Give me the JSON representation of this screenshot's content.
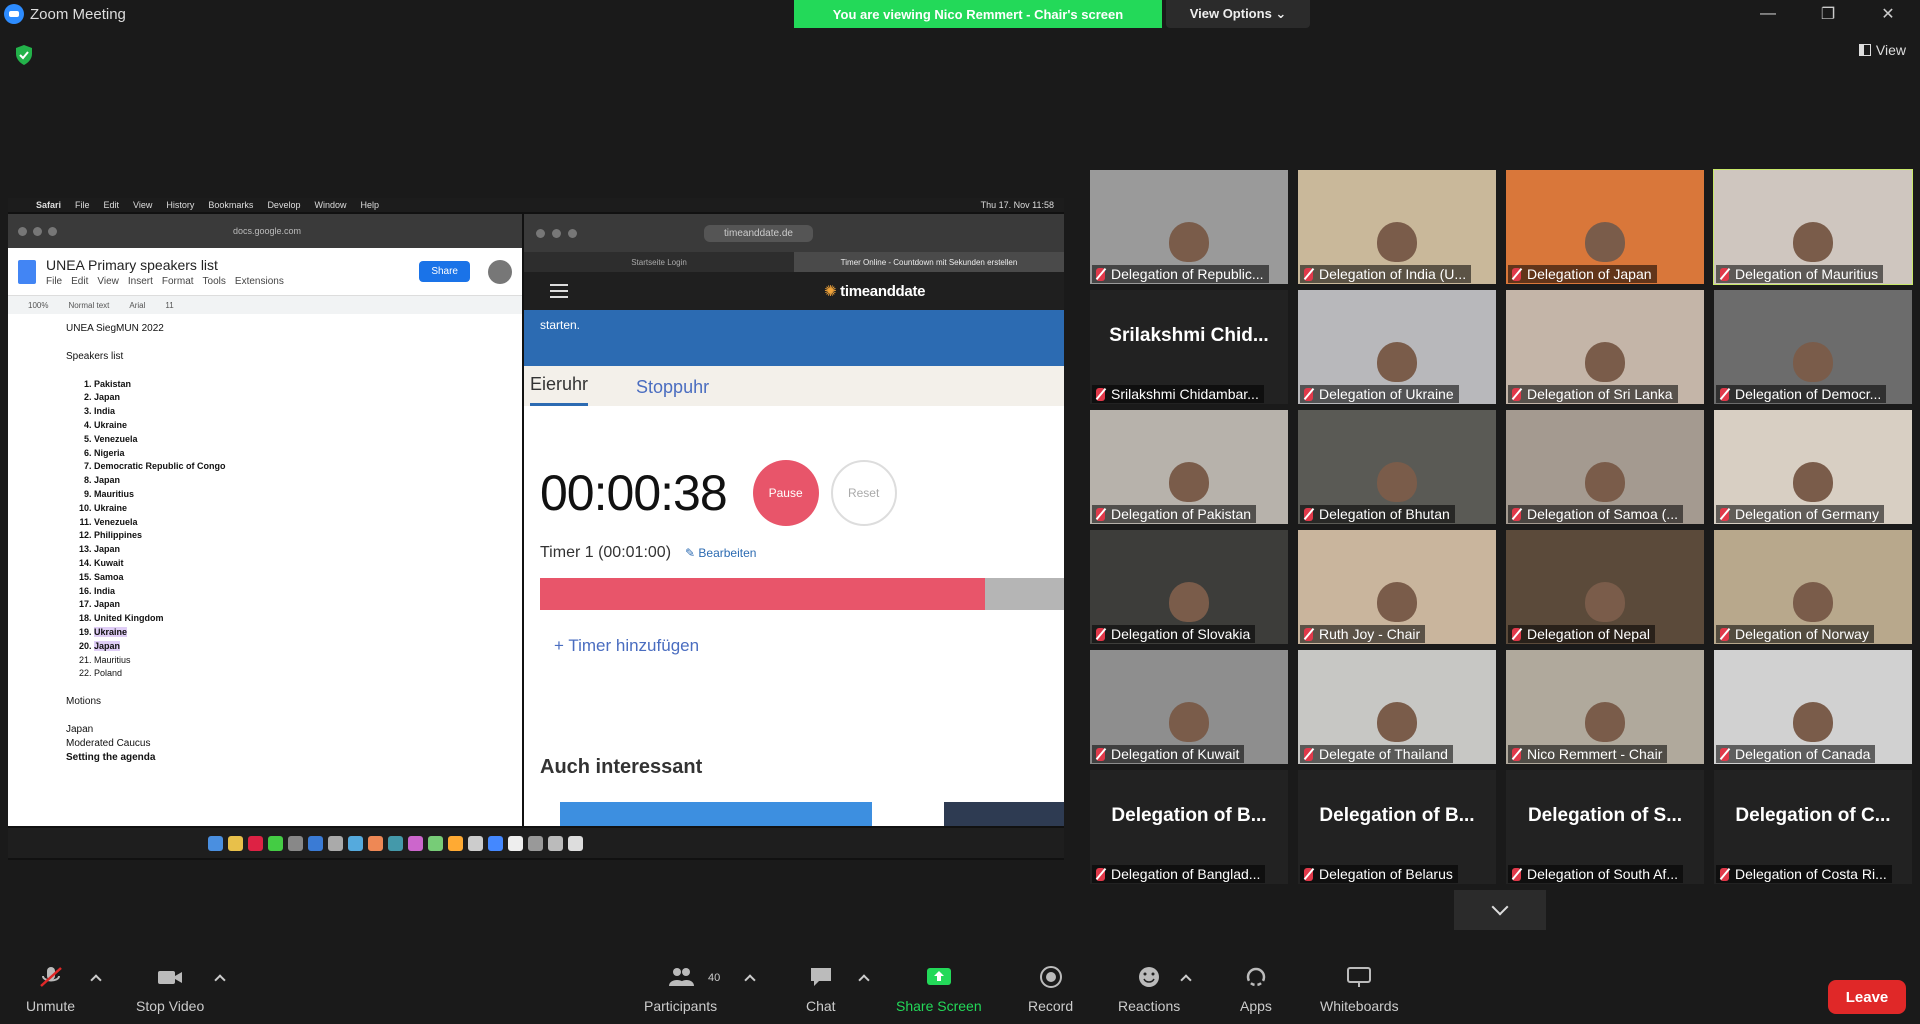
{
  "window": {
    "title": "Zoom Meeting",
    "minimize": "—",
    "restore": "❐",
    "close": "✕"
  },
  "share_banner": "You are viewing Nico Remmert - Chair's screen",
  "view_options": "View Options ⌄",
  "view_button": "View",
  "shared_screen": {
    "mac_menu": [
      "Safari",
      "File",
      "Edit",
      "View",
      "History",
      "Bookmarks",
      "Develop",
      "Window",
      "Help"
    ],
    "mac_clock": "Thu 17. Nov 11:58",
    "doc": {
      "url": "docs.google.com",
      "title": "UNEA Primary speakers list",
      "menu": [
        "File",
        "Edit",
        "View",
        "Insert",
        "Format",
        "Tools",
        "Extensions"
      ],
      "share_label": "Share",
      "toolbar": [
        "100%",
        "Normal text",
        "Arial",
        "11"
      ],
      "heading": "UNEA SiegMUN 2022",
      "speakers_label": "Speakers list",
      "speakers": [
        "Pakistan",
        "Japan",
        "India",
        "Ukraine",
        "Venezuela",
        "Nigeria",
        "Democratic Republic of Congo",
        "Japan",
        "Mauritius",
        "Ukraine",
        "Venezuela",
        "Philippines",
        "Japan",
        "Kuwait",
        "Samoa",
        "India",
        "Japan",
        "United Kingdom",
        "Ukraine",
        "Japan",
        "Mauritius",
        "Poland"
      ],
      "motions_label": "Motions",
      "motions": [
        "Japan",
        "Moderated Caucus",
        "Setting the agenda"
      ]
    },
    "browser": {
      "url": "timeanddate.de",
      "tabs": [
        "Startseite Login",
        "Timer Online - Countdown mit Sekunden erstellen"
      ],
      "logo": "timeanddate",
      "banner_text": "starten.",
      "tab_eieruhr": "Eieruhr",
      "tab_stoppuhr": "Stoppuhr",
      "timer_value": "00:00:38",
      "pause_label": "Pause",
      "reset_label": "Reset",
      "timer_name": "Timer 1 (00:01:00)",
      "edit_label": "Bearbeiten",
      "progress_elapsed": 0.85,
      "add_timer": "+ Timer hinzufügen",
      "also_heading": "Auch interessant"
    }
  },
  "participants": [
    {
      "label": "Delegation of Republic...",
      "bg": "#9a9a9a"
    },
    {
      "label": "Delegation of India (U...",
      "bg": "#c9b89a"
    },
    {
      "label": "Delegation of Japan",
      "bg": "#d9773a"
    },
    {
      "label": "Delegation of Mauritius",
      "bg": "#cfc6bf",
      "active": true
    },
    {
      "label": "Srilakshmi Chidambar...",
      "big": "Srilakshmi  Chid...",
      "bg": "#222222"
    },
    {
      "label": "Delegation of Ukraine",
      "bg": "#b8b8bb"
    },
    {
      "label": "Delegation of Sri Lanka",
      "bg": "#c4b5a8"
    },
    {
      "label": "Delegation of Democr...",
      "bg": "#6c6c6c"
    },
    {
      "label": "Delegation of Pakistan",
      "bg": "#b7b2ab"
    },
    {
      "label": "Delegation of Bhutan",
      "bg": "#5a5a55"
    },
    {
      "label": "Delegation of Samoa (...",
      "bg": "#a49a90"
    },
    {
      "label": "Delegation of Germany",
      "bg": "#d8cfc3"
    },
    {
      "label": "Delegation of Slovakia",
      "bg": "#3d3d3a"
    },
    {
      "label": "Ruth Joy - Chair",
      "bg": "#c9b59d"
    },
    {
      "label": "Delegation of Nepal",
      "bg": "#5b4a3a"
    },
    {
      "label": "Delegation of Norway",
      "bg": "#b8a88c"
    },
    {
      "label": "Delegation of Kuwait",
      "bg": "#8e8e8e"
    },
    {
      "label": "Delegate of Thailand",
      "bg": "#c7c7c4"
    },
    {
      "label": "Nico Remmert - Chair",
      "bg": "#b0a99c"
    },
    {
      "label": "Delegation of Canada",
      "bg": "#d1d1d1"
    },
    {
      "label": "Delegation of Banglad...",
      "big": "Delegation of B...",
      "bg": "#222222"
    },
    {
      "label": "Delegation of Belarus",
      "big": "Delegation of B...",
      "bg": "#222222"
    },
    {
      "label": "Delegation of South Af...",
      "big": "Delegation of S...",
      "bg": "#222222"
    },
    {
      "label": "Delegation of Costa Ri...",
      "big": "Delegation of C...",
      "bg": "#222222"
    }
  ],
  "toolbar": {
    "unmute": "Unmute",
    "stop_video": "Stop Video",
    "participants": "Participants",
    "participants_count": "40",
    "chat": "Chat",
    "share_screen": "Share Screen",
    "record": "Record",
    "reactions": "Reactions",
    "apps": "Apps",
    "whiteboards": "Whiteboards",
    "leave": "Leave"
  },
  "colors": {
    "share_green": "#23d959",
    "leave_red": "#e02828",
    "active_speaker": "#c8e86a",
    "timer_pink": "#e8556a"
  }
}
